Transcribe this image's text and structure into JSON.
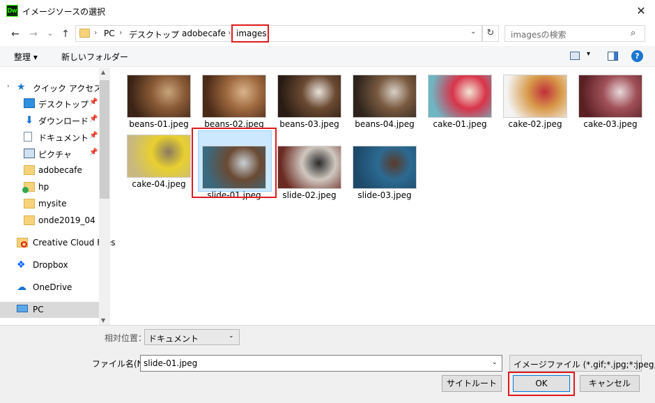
{
  "window": {
    "title": "イメージソースの選択",
    "app_icon_text": "Dw"
  },
  "nav": {
    "back": "←",
    "forward": "→",
    "recent": "⌄",
    "up": "↑"
  },
  "address": {
    "crumbs": [
      "PC",
      "デスクトップ",
      "adobecafe",
      "images"
    ],
    "separator": "›",
    "dropdown": "⌄",
    "refresh": "↻"
  },
  "search": {
    "placeholder": "imagesの検索",
    "icon": "⌕"
  },
  "commands": {
    "organize": "整理 ▾",
    "new_folder": "新しいフォルダー",
    "view_dropdown": "▾",
    "help": "?"
  },
  "sidebar": {
    "quick_access": "クイック アクセス",
    "quick_items": [
      {
        "label": "デスクトップ",
        "pinned": true
      },
      {
        "label": "ダウンロード",
        "pinned": true
      },
      {
        "label": "ドキュメント",
        "pinned": true
      },
      {
        "label": "ピクチャ",
        "pinned": true
      },
      {
        "label": "adobecafe",
        "pinned": false
      },
      {
        "label": "hp",
        "pinned": false
      },
      {
        "label": "mysite",
        "pinned": false
      },
      {
        "label": "onde2019_04",
        "pinned": false
      }
    ],
    "creative_cloud": "Creative Cloud Files",
    "dropbox": "Dropbox",
    "onedrive": "OneDrive",
    "pc": "PC",
    "pin_glyph": "📌"
  },
  "files": [
    {
      "name": "beans-01.jpeg",
      "colors": [
        "#3b2416",
        "#8a5a36",
        "#c8a47a"
      ]
    },
    {
      "name": "beans-02.jpeg",
      "colors": [
        "#4a2a18",
        "#a06a40",
        "#d9b48c"
      ]
    },
    {
      "name": "beans-03.jpeg",
      "colors": [
        "#2a1c14",
        "#6b4a32",
        "#e8e2da"
      ]
    },
    {
      "name": "beans-04.jpeg",
      "colors": [
        "#2e241c",
        "#7a5a40",
        "#d8d0c6"
      ]
    },
    {
      "name": "cake-01.jpeg",
      "colors": [
        "#6fb6c4",
        "#d8344a",
        "#f2e6d4"
      ]
    },
    {
      "name": "cake-02.jpeg",
      "colors": [
        "#f4f4f4",
        "#d89a4a",
        "#c0303a"
      ]
    },
    {
      "name": "cake-03.jpeg",
      "colors": [
        "#5a2024",
        "#a05058",
        "#e8d8da"
      ]
    },
    {
      "name": "cake-04.jpeg",
      "colors": [
        "#c8b880",
        "#e8d030",
        "#8a7a60"
      ]
    },
    {
      "name": "slide-01.jpeg",
      "colors": [
        "#3a6a80",
        "#6a4a34",
        "#c8d0d4"
      ]
    },
    {
      "name": "slide-02.jpeg",
      "colors": [
        "#6a2a22",
        "#d0c8c0",
        "#2a2a2a"
      ]
    },
    {
      "name": "slide-03.jpeg",
      "colors": [
        "#1e4a6a",
        "#2c6a92",
        "#5a3a2a"
      ]
    }
  ],
  "selected_file": "slide-01.jpeg",
  "bottom": {
    "relative_label": "相対位置：",
    "relative_value": "ドキュメント",
    "filename_label": "ファイル名(N):",
    "filename_value": "slide-01.jpeg",
    "filter_value": "イメージファイル (*.gif;*.jpg;*.jpeg;",
    "dropdown": "⌄",
    "site_root": "サイトルート",
    "ok": "OK",
    "cancel": "キャンセル"
  },
  "colors": {
    "highlight_red": "#e0191c",
    "selection_blue": "#cce8ff",
    "accent": "#0078d7"
  }
}
